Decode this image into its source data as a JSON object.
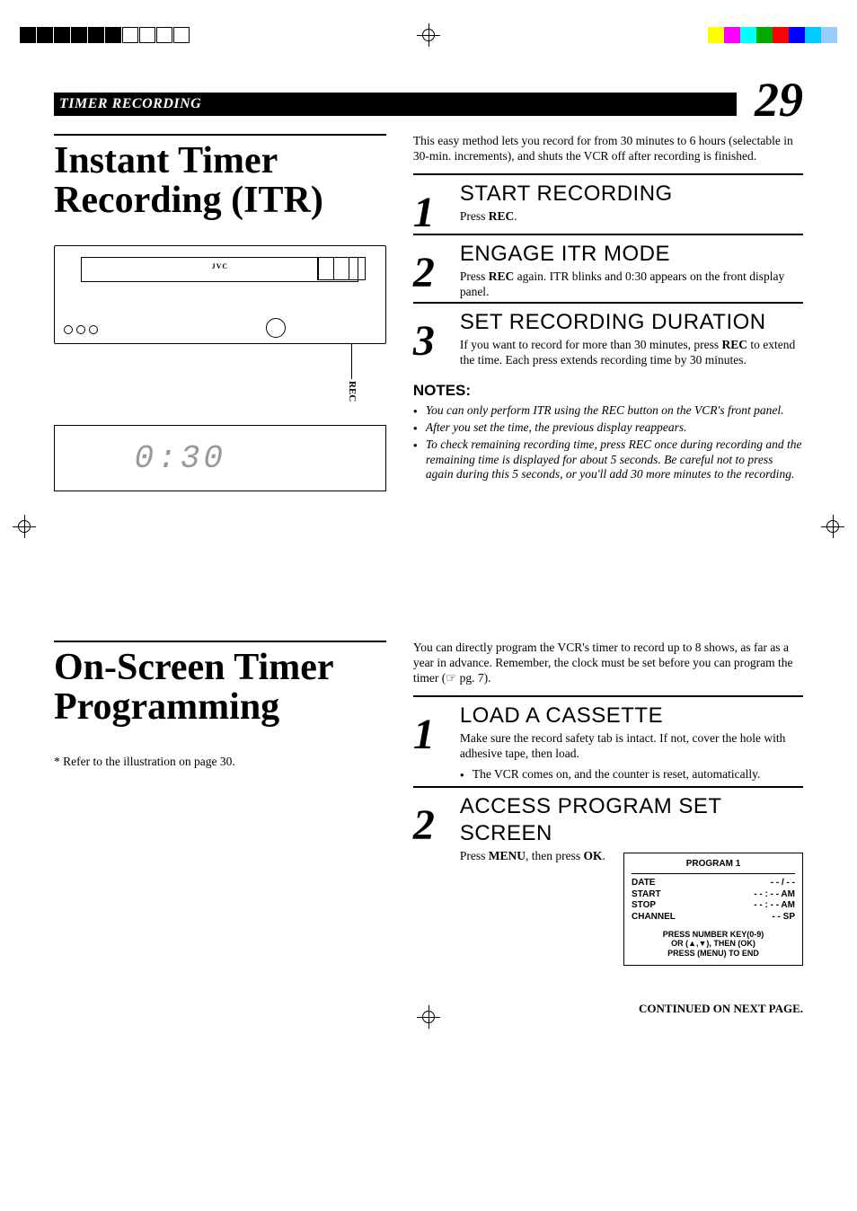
{
  "header": {
    "section": "TIMER RECORDING",
    "page_number": "29"
  },
  "feature1": {
    "title": "Instant Timer Recording (ITR)",
    "intro": "This easy method lets you record for from 30 minutes to 6 hours (selectable in 30-min. increments), and shuts the VCR off after recording is finished.",
    "steps": [
      {
        "num": "1",
        "title": "START RECORDING",
        "body_pre": "Press ",
        "body_bold": "REC",
        "body_post": "."
      },
      {
        "num": "2",
        "title": "ENGAGE ITR MODE",
        "body_pre": "Press ",
        "body_bold": "REC",
        "body_post": " again. ITR blinks and 0:30 appears on the front display panel."
      },
      {
        "num": "3",
        "title": "SET RECORDING DURATION",
        "body_pre": "If you want to record for more than 30 minutes, press ",
        "body_bold": "REC",
        "body_post": " to extend the time. Each press extends recording time by 30 minutes."
      }
    ],
    "notes_head": "NOTES:",
    "notes": [
      "You can only perform ITR using the REC button on the VCR's front panel.",
      "After you set the time, the previous display reappears.",
      "To check remaining recording time, press REC once during recording and the remaining time is displayed for about 5 seconds. Be careful not to press again during this 5 seconds, or you'll add 30 more minutes to the recording."
    ],
    "vcr_brand": "JVC",
    "rec_label": "REC",
    "display_time": "0:30"
  },
  "feature2": {
    "title": "On-Screen Timer Programming",
    "footnote": "* Refer to the illustration on page 30.",
    "intro": "You can directly program the VCR's timer to record up to 8 shows, as far as a year in advance. Remember, the clock must be set before you can program the timer (☞ pg. 7).",
    "steps": [
      {
        "num": "1",
        "title": "LOAD A CASSETTE",
        "body": "Make sure the record safety tab is intact. If not, cover the hole with adhesive tape, then load.",
        "bullet": "The VCR comes on, and the counter is reset, automatically."
      },
      {
        "num": "2",
        "title": "ACCESS PROGRAM SET SCREEN",
        "body_pre": "Press ",
        "body_bold1": "MENU",
        "body_mid": ", then press ",
        "body_bold2": "OK",
        "body_post": "."
      }
    ],
    "prog_screen": {
      "title": "PROGRAM 1",
      "rows": [
        {
          "label": "DATE",
          "value": "- - / - -"
        },
        {
          "label": "START",
          "value": "- - : - -  AM"
        },
        {
          "label": "STOP",
          "value": "- - : - -  AM"
        },
        {
          "label": "CHANNEL",
          "value": "- -  SP"
        }
      ],
      "msg1": "PRESS NUMBER KEY(0-9)",
      "msg2": "OR (▲,▼), THEN (OK)",
      "msg3": "PRESS (MENU) TO END"
    }
  },
  "continued": "CONTINUED ON NEXT PAGE."
}
